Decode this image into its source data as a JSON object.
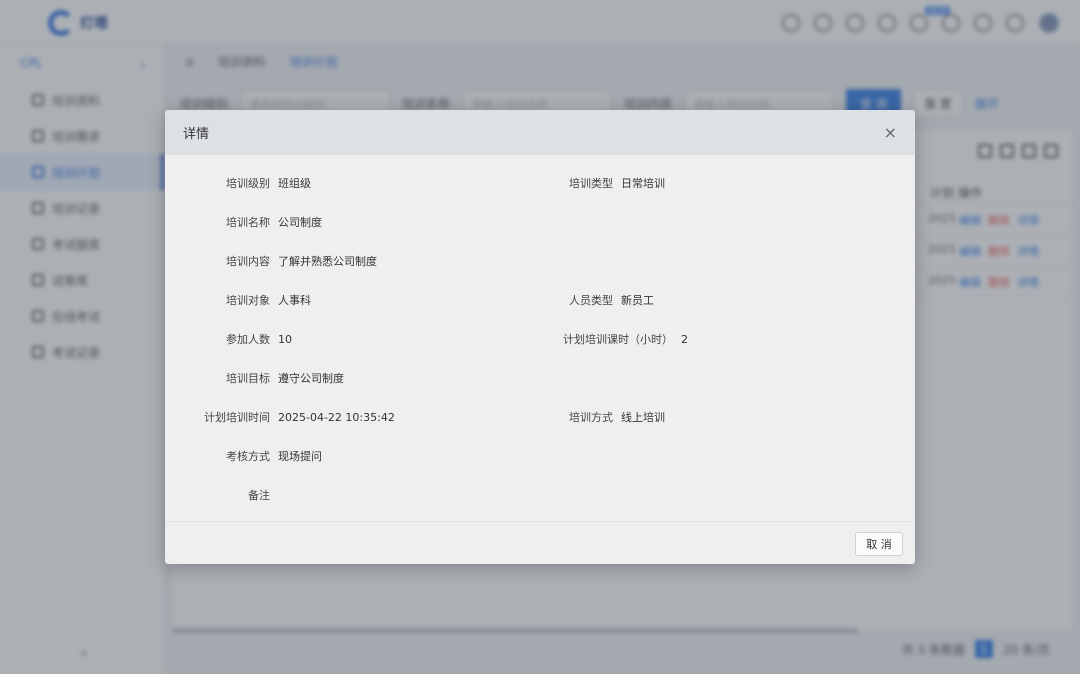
{
  "app": {
    "brand": "灯塔",
    "badge": "NEW"
  },
  "sidebar": {
    "group": "CPL",
    "items": [
      {
        "label": "培训资料"
      },
      {
        "label": "培训需求"
      },
      {
        "label": "培训计划"
      },
      {
        "label": "培训记录"
      },
      {
        "label": "考试题库"
      },
      {
        "label": "试卷库"
      },
      {
        "label": "在线考试"
      },
      {
        "label": "考试记录"
      }
    ],
    "collapse": "«"
  },
  "tabs": [
    {
      "label": "培训资料"
    },
    {
      "label": "培训计划"
    }
  ],
  "filters": {
    "level_label": "培训级别",
    "name_label": "培训名称",
    "content_label": "培训内容",
    "level_placeholder": "请选择培训级别",
    "name_placeholder": "请输入培训名称",
    "content_placeholder": "请输入培训内容",
    "search": "查 询",
    "reset": "重 置",
    "expand": "展开"
  },
  "table": {
    "headers": {
      "plan": "计划",
      "ops": "操作"
    },
    "rows": [
      {
        "year": "2025",
        "edit": "编辑",
        "del": "删除",
        "detail": "详情"
      },
      {
        "year": "2025",
        "edit": "编辑",
        "del": "删除",
        "detail": "详情"
      },
      {
        "year": "2025",
        "edit": "编辑",
        "del": "删除",
        "detail": "详情"
      }
    ]
  },
  "pager": {
    "total": "共 3 条数据",
    "page": "1",
    "size": "20 条/页"
  },
  "modal": {
    "title": "详情",
    "close": "×",
    "fields": {
      "level": {
        "label": "培训级别",
        "value": "班组级"
      },
      "type": {
        "label": "培训类型",
        "value": "日常培训"
      },
      "name": {
        "label": "培训名称",
        "value": "公司制度"
      },
      "content": {
        "label": "培训内容",
        "value": "了解并熟悉公司制度"
      },
      "target": {
        "label": "培训对象",
        "value": "人事科"
      },
      "staff_type": {
        "label": "人员类型",
        "value": "新员工"
      },
      "count": {
        "label": "参加人数",
        "value": "10"
      },
      "hours": {
        "label": "计划培训课时（小时）",
        "value": "2"
      },
      "goal": {
        "label": "培训目标",
        "value": "遵守公司制度"
      },
      "time": {
        "label": "计划培训时间",
        "value": "2025-04-22 10:35:42"
      },
      "method": {
        "label": "培训方式",
        "value": "线上培训"
      },
      "assess": {
        "label": "考核方式",
        "value": "现场提问"
      },
      "remark": {
        "label": "备注",
        "value": ""
      }
    },
    "cancel": "取 消"
  }
}
